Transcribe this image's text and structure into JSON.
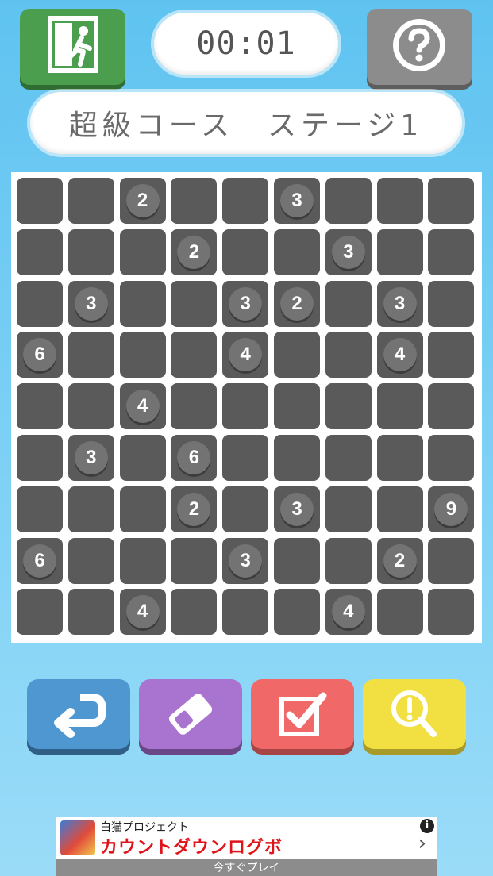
{
  "header": {
    "exit_icon": "emergency-exit-icon",
    "help_icon": "question-mark-icon",
    "timer": "00:01",
    "title": "超級コース　ステージ1"
  },
  "board": {
    "size": 9,
    "cells": [
      [
        null,
        null,
        2,
        null,
        null,
        3,
        null,
        null,
        null
      ],
      [
        null,
        null,
        null,
        2,
        null,
        null,
        3,
        null,
        null
      ],
      [
        null,
        3,
        null,
        null,
        3,
        2,
        null,
        3,
        null
      ],
      [
        6,
        null,
        null,
        null,
        4,
        null,
        null,
        4,
        null
      ],
      [
        null,
        null,
        4,
        null,
        null,
        null,
        null,
        null,
        null
      ],
      [
        null,
        3,
        null,
        6,
        null,
        null,
        null,
        null,
        null
      ],
      [
        null,
        null,
        null,
        2,
        null,
        3,
        null,
        null,
        9
      ],
      [
        6,
        null,
        null,
        null,
        3,
        null,
        null,
        2,
        null
      ],
      [
        null,
        null,
        4,
        null,
        null,
        null,
        4,
        null,
        null
      ]
    ]
  },
  "tools": {
    "undo_icon": "undo-arrow-icon",
    "erase_icon": "eraser-icon",
    "check_icon": "checkbox-check-icon",
    "hint_icon": "magnifier-exclamation-icon"
  },
  "colors": {
    "background": "#6ccaf3",
    "exit": "#4a9e4e",
    "help": "#8c8c8c",
    "cell": "#5a5a5a",
    "undo": "#4f97d0",
    "erase": "#a874cf",
    "check": "#f06868",
    "hint": "#f2e042"
  },
  "ad": {
    "title": "白猫プロジェクト",
    "main": "カウントダウンログボ",
    "cta": "今すぐプレイ",
    "info": "i",
    "arrow": "›"
  }
}
